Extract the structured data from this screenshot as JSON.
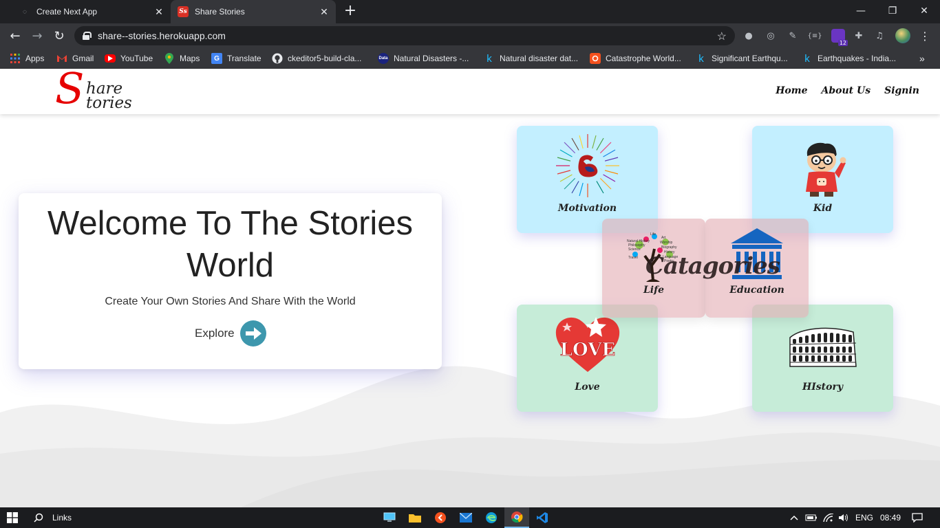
{
  "browser": {
    "tabs": [
      {
        "title": "Create Next App",
        "active": false
      },
      {
        "title": "Share Stories",
        "active": true
      }
    ],
    "favicon_text": "Ss",
    "url": "share--stories.herokuapp.com",
    "extension_badge": "12",
    "bookmarks": [
      {
        "label": "Apps",
        "icon": "apps-grid-icon"
      },
      {
        "label": "Gmail",
        "icon": "gmail-icon"
      },
      {
        "label": "YouTube",
        "icon": "youtube-icon"
      },
      {
        "label": "Maps",
        "icon": "maps-icon"
      },
      {
        "label": "Translate",
        "icon": "translate-icon"
      },
      {
        "label": "ckeditor5-build-cla...",
        "icon": "github-icon"
      },
      {
        "label": "Natural Disasters -...",
        "icon": "data-icon"
      },
      {
        "label": "Natural disaster dat...",
        "icon": "kaggle-icon"
      },
      {
        "label": "Catastrophe World...",
        "icon": "catastrophe-icon"
      },
      {
        "label": "Significant Earthqu...",
        "icon": "kaggle-icon"
      },
      {
        "label": "Earthquakes - India...",
        "icon": "kaggle-icon"
      }
    ],
    "bookmark_icon_text": {
      "apps": "",
      "translate": "G",
      "data": "Data",
      "kaggle": "k"
    }
  },
  "site": {
    "logo": {
      "s": "S",
      "hare": "hare",
      "tories": "tories"
    },
    "nav": [
      "Home",
      "About Us",
      "Signin"
    ]
  },
  "hero": {
    "title": "Welcome To The Stories World",
    "subtitle": "Create Your Own Stories And Share With the World",
    "explore_label": "Explore"
  },
  "categories": {
    "center_label": "Catagories",
    "items": [
      {
        "label": "Motivation",
        "color": "#c3efff"
      },
      {
        "label": "Kid",
        "color": "#c3efff"
      },
      {
        "label": "Life",
        "color": "#e2acb2"
      },
      {
        "label": "Education",
        "color": "#e2acb2"
      },
      {
        "label": "Love",
        "color": "#c6ecd8"
      },
      {
        "label": "HIstory",
        "color": "#c6ecd8"
      }
    ],
    "art_text": {
      "love": "LOVE",
      "life_tree_words": [
        "Life",
        "Natural History",
        "Art",
        "Worship",
        "Philosophy",
        "Biography",
        "Science",
        "History",
        "Language",
        "Poetry",
        "Travel"
      ]
    }
  },
  "taskbar": {
    "search_label": "Links",
    "language": "ENG",
    "time": "08:49"
  },
  "colors": {
    "accent_red": "#e60000",
    "explore_button": "#3d97ad",
    "card_blue": "#c3efff",
    "card_green": "#c6ecd8",
    "card_pink": "#e2acb2"
  }
}
